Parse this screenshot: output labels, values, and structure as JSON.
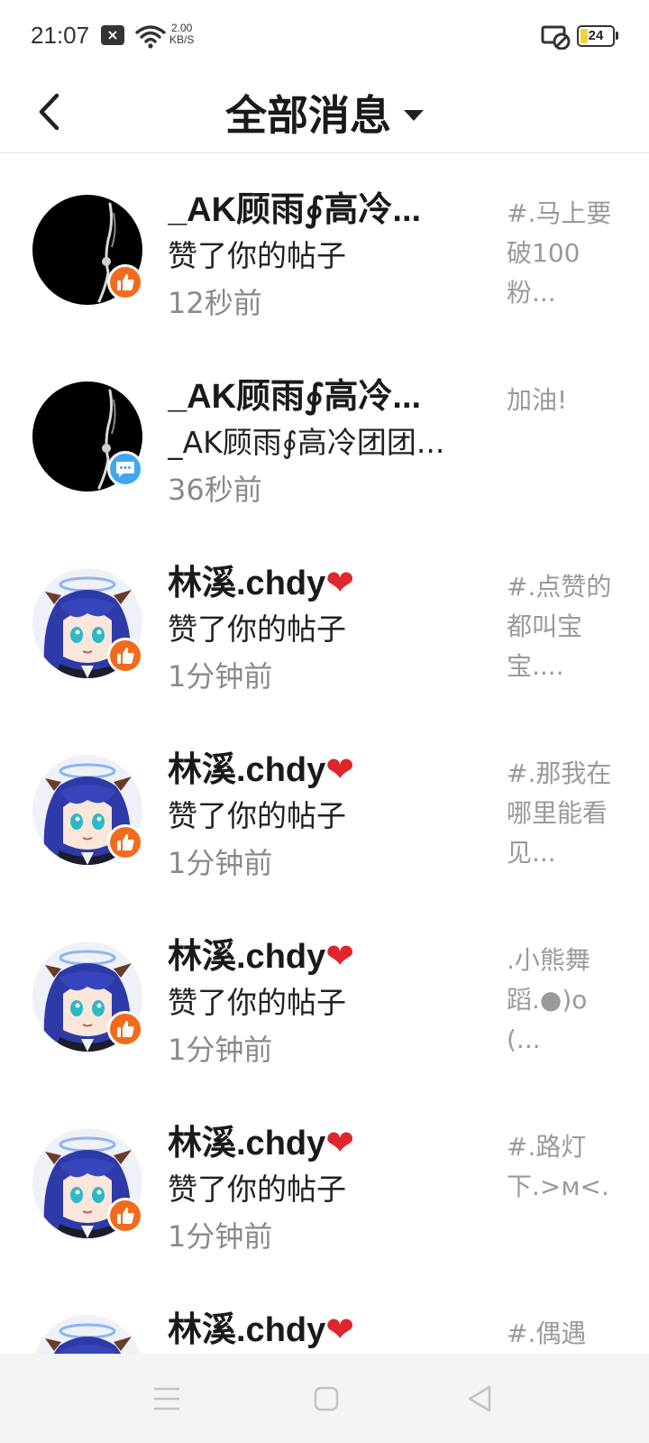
{
  "status_bar": {
    "time": "21:07",
    "notification_icon": "close-box-icon",
    "net_speed_value": "2.00",
    "net_speed_unit": "KB/S",
    "battery_level": "24"
  },
  "header": {
    "title": "全部消息",
    "back_icon": "chevron-left-icon",
    "dropdown_icon": "caret-down-icon"
  },
  "notifications": [
    {
      "name": "_AK顾雨∮高冷...",
      "heart": "",
      "action": "赞了你的帖子",
      "time": "12秒前",
      "preview": "#.马上要破100粉...",
      "badge": "like",
      "avatar": "dark"
    },
    {
      "name": "_AK顾雨∮高冷...",
      "heart": "",
      "action": "_AK顾雨∮高冷团团...",
      "time": "36秒前",
      "preview": "加油!",
      "badge": "comment",
      "avatar": "dark"
    },
    {
      "name": "林溪.chdy",
      "heart": "❤",
      "action": "赞了你的帖子",
      "time": "1分钟前",
      "preview": "#.点赞的都叫宝宝....",
      "badge": "like",
      "avatar": "anime"
    },
    {
      "name": "林溪.chdy",
      "heart": "❤",
      "action": "赞了你的帖子",
      "time": "1分钟前",
      "preview": "#.那我在哪里能看见...",
      "badge": "like",
      "avatar": "anime"
    },
    {
      "name": "林溪.chdy",
      "heart": "❤",
      "action": "赞了你的帖子",
      "time": "1分钟前",
      "preview": ".小熊舞蹈.●)o(...",
      "badge": "like",
      "avatar": "anime"
    },
    {
      "name": "林溪.chdy",
      "heart": "❤",
      "action": "赞了你的帖子",
      "time": "1分钟前",
      "preview": "#.路灯下.>ᴍ<.",
      "badge": "like",
      "avatar": "anime"
    },
    {
      "name": "林溪.chdy",
      "heart": "❤",
      "action": "",
      "time": "",
      "preview": "#.偶遇",
      "badge": "",
      "avatar": "anime"
    }
  ],
  "nav_bar": {
    "menu_icon": "menu-icon",
    "home_icon": "square-home-icon",
    "back_icon": "triangle-back-icon"
  },
  "colors": {
    "like_badge": "#f26b1d",
    "comment_badge": "#3fa7ee",
    "heart": "#e0262b",
    "secondary_text": "#8a8a8a"
  }
}
